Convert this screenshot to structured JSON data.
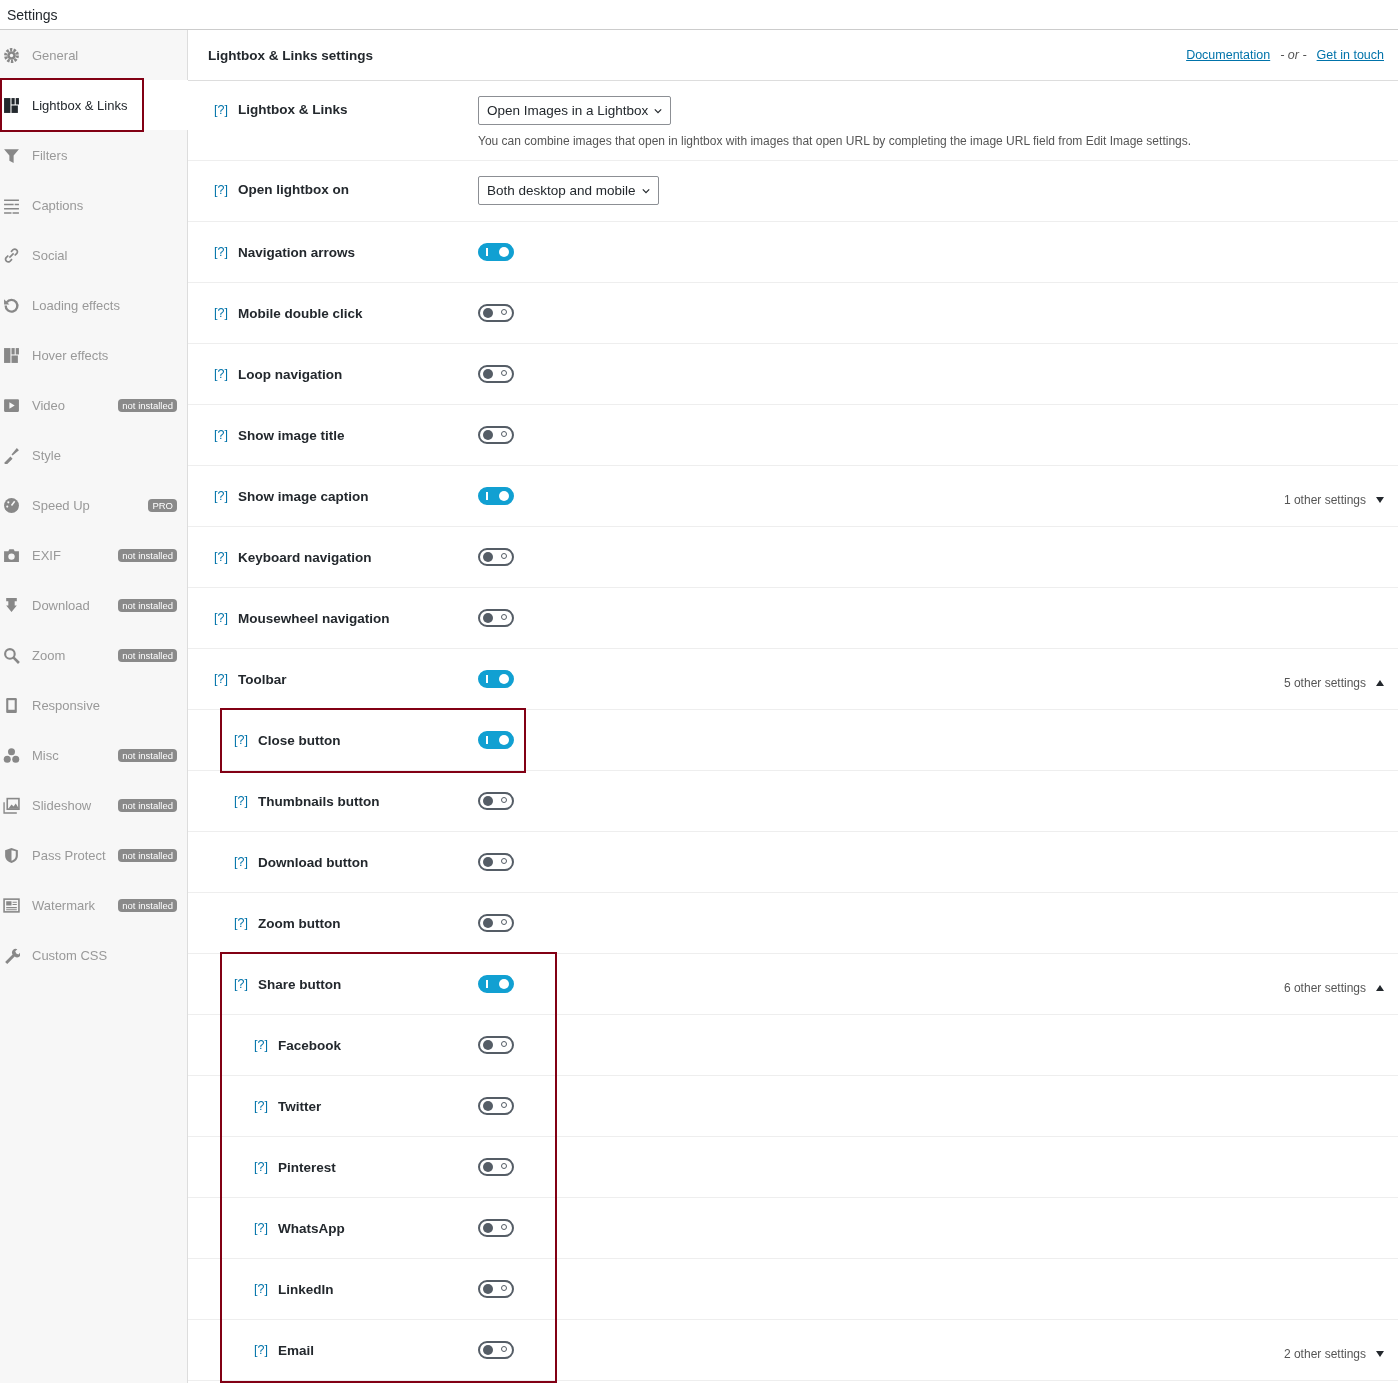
{
  "title": "Settings",
  "sidebar": {
    "items": [
      {
        "label": "General",
        "selected": false,
        "highlighted": false
      },
      {
        "label": "Lightbox & Links",
        "selected": true,
        "highlighted": true
      },
      {
        "label": "Filters",
        "selected": false,
        "highlighted": false
      },
      {
        "label": "Captions",
        "selected": false,
        "highlighted": false
      },
      {
        "label": "Social",
        "selected": false,
        "highlighted": false
      },
      {
        "label": "Loading effects",
        "selected": false,
        "highlighted": false
      },
      {
        "label": "Hover effects",
        "selected": false,
        "highlighted": false
      },
      {
        "label": "Video",
        "badge": "not installed",
        "selected": false,
        "highlighted": false
      },
      {
        "label": "Style",
        "selected": false,
        "highlighted": false
      },
      {
        "label": "Speed Up",
        "badge": "PRO",
        "selected": false,
        "highlighted": false
      },
      {
        "label": "EXIF",
        "badge": "not installed",
        "selected": false,
        "highlighted": false
      },
      {
        "label": "Download",
        "badge": "not installed",
        "selected": false,
        "highlighted": false
      },
      {
        "label": "Zoom",
        "badge": "not installed",
        "selected": false,
        "highlighted": false
      },
      {
        "label": "Responsive",
        "selected": false,
        "highlighted": false
      },
      {
        "label": "Misc",
        "badge": "not installed",
        "selected": false,
        "highlighted": false
      },
      {
        "label": "Slideshow",
        "badge": "not installed",
        "selected": false,
        "highlighted": false
      },
      {
        "label": "Pass Protect",
        "badge": "not installed",
        "selected": false,
        "highlighted": false
      },
      {
        "label": "Watermark",
        "badge": "not installed",
        "selected": false,
        "highlighted": false
      },
      {
        "label": "Custom CSS",
        "selected": false,
        "highlighted": false
      }
    ]
  },
  "panel": {
    "title": "Lightbox & Links settings",
    "links": [
      {
        "label": "Documentation"
      },
      {
        "label": "Get in touch"
      }
    ],
    "separator": "- or -",
    "settings": [
      {
        "kind": "select",
        "help": "[?]",
        "label": "Lightbox & Links",
        "value": "Open Images in a Lightbox",
        "description": "You can combine images that open in lightbox with images that open URL by completing the image URL field from Edit Image settings."
      },
      {
        "kind": "select",
        "help": "[?]",
        "label": "Open lightbox on",
        "value": "Both desktop and mobile"
      },
      {
        "kind": "toggle",
        "help": "[?]",
        "label": "Navigation arrows",
        "on": true
      },
      {
        "kind": "toggle",
        "help": "[?]",
        "label": "Mobile double click",
        "on": false
      },
      {
        "kind": "toggle",
        "help": "[?]",
        "label": "Loop navigation",
        "on": false
      },
      {
        "kind": "toggle",
        "help": "[?]",
        "label": "Show image title",
        "on": false
      },
      {
        "kind": "toggle",
        "help": "[?]",
        "label": "Show image caption",
        "on": true,
        "more": "1 other settings",
        "expanded": false
      },
      {
        "kind": "toggle",
        "help": "[?]",
        "label": "Keyboard navigation",
        "on": false
      },
      {
        "kind": "toggle",
        "help": "[?]",
        "label": "Mousewheel navigation",
        "on": false
      },
      {
        "kind": "toggle",
        "help": "[?]",
        "label": "Toolbar",
        "on": true,
        "more": "5 other settings",
        "expanded": true,
        "children": [
          {
            "kind": "toggle",
            "help": "[?]",
            "label": "Close button",
            "on": true,
            "highlighted": true
          },
          {
            "kind": "toggle",
            "help": "[?]",
            "label": "Thumbnails button",
            "on": false
          },
          {
            "kind": "toggle",
            "help": "[?]",
            "label": "Download button",
            "on": false
          },
          {
            "kind": "toggle",
            "help": "[?]",
            "label": "Zoom button",
            "on": false
          },
          {
            "kind": "toggle",
            "help": "[?]",
            "label": "Share button",
            "on": true,
            "more": "6 other settings",
            "expanded": true,
            "highlighted": true,
            "children": [
              {
                "kind": "toggle",
                "help": "[?]",
                "label": "Facebook",
                "on": false
              },
              {
                "kind": "toggle",
                "help": "[?]",
                "label": "Twitter",
                "on": false
              },
              {
                "kind": "toggle",
                "help": "[?]",
                "label": "Pinterest",
                "on": false
              },
              {
                "kind": "toggle",
                "help": "[?]",
                "label": "WhatsApp",
                "on": false
              },
              {
                "kind": "toggle",
                "help": "[?]",
                "label": "LinkedIn",
                "on": false
              },
              {
                "kind": "toggle",
                "help": "[?]",
                "label": "Email",
                "on": false,
                "more": "2 other settings",
                "expanded": false
              }
            ]
          }
        ]
      }
    ]
  }
}
